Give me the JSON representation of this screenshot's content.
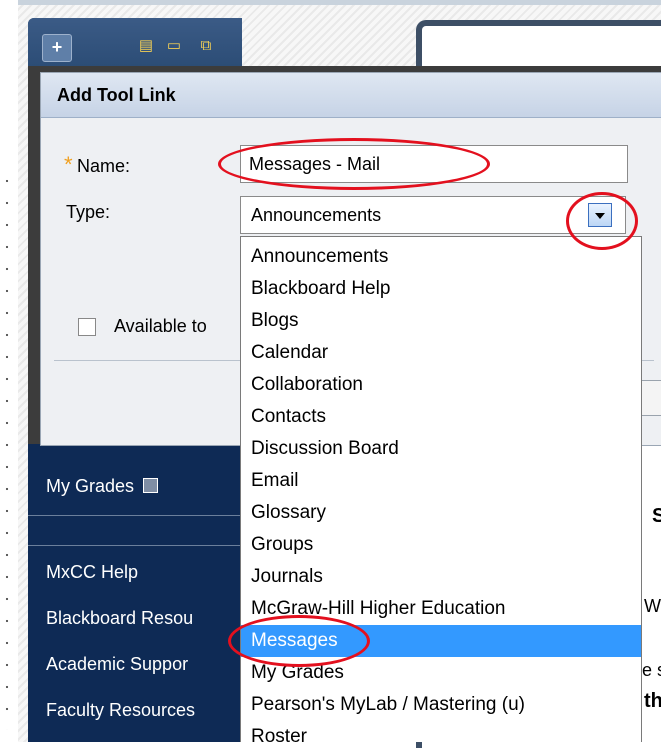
{
  "toolbar": {
    "add_icon": "plus-icon",
    "icons": [
      "list-icon",
      "folder-icon",
      "window-icon",
      "refresh-icon",
      "sort-icon"
    ]
  },
  "dialog": {
    "title": "Add Tool Link",
    "name_label": "Name:",
    "required_marker": "*",
    "name_value": "Messages - Mail",
    "type_label": "Type:",
    "type_selected": "Announcements",
    "available_label": "Available to"
  },
  "dropdown": {
    "options": [
      "Announcements",
      "Blackboard Help",
      "Blogs",
      "Calendar",
      "Collaboration",
      "Contacts",
      "Discussion Board",
      "Email",
      "Glossary",
      "Groups",
      "Journals",
      "McGraw-Hill Higher Education",
      "Messages",
      "My Grades",
      "Pearson's MyLab / Mastering (u)",
      "Roster"
    ],
    "highlighted": "Messages"
  },
  "course_menu": {
    "my_grades": "My Grades",
    "mxcc_help": "MxCC Help",
    "blackboard_resources": "Blackboard Resou",
    "academic_support": "Academic Suppor",
    "faculty_resources": "Faculty Resources"
  },
  "right_panel": {
    "heading_fragment": "S",
    "line1": "W",
    "line2": "e s",
    "line3": "th",
    "line4": "t"
  },
  "colors": {
    "annotation_red": "#e3101e",
    "selection_blue": "#3399ff",
    "menu_navy": "#0e2a55"
  }
}
